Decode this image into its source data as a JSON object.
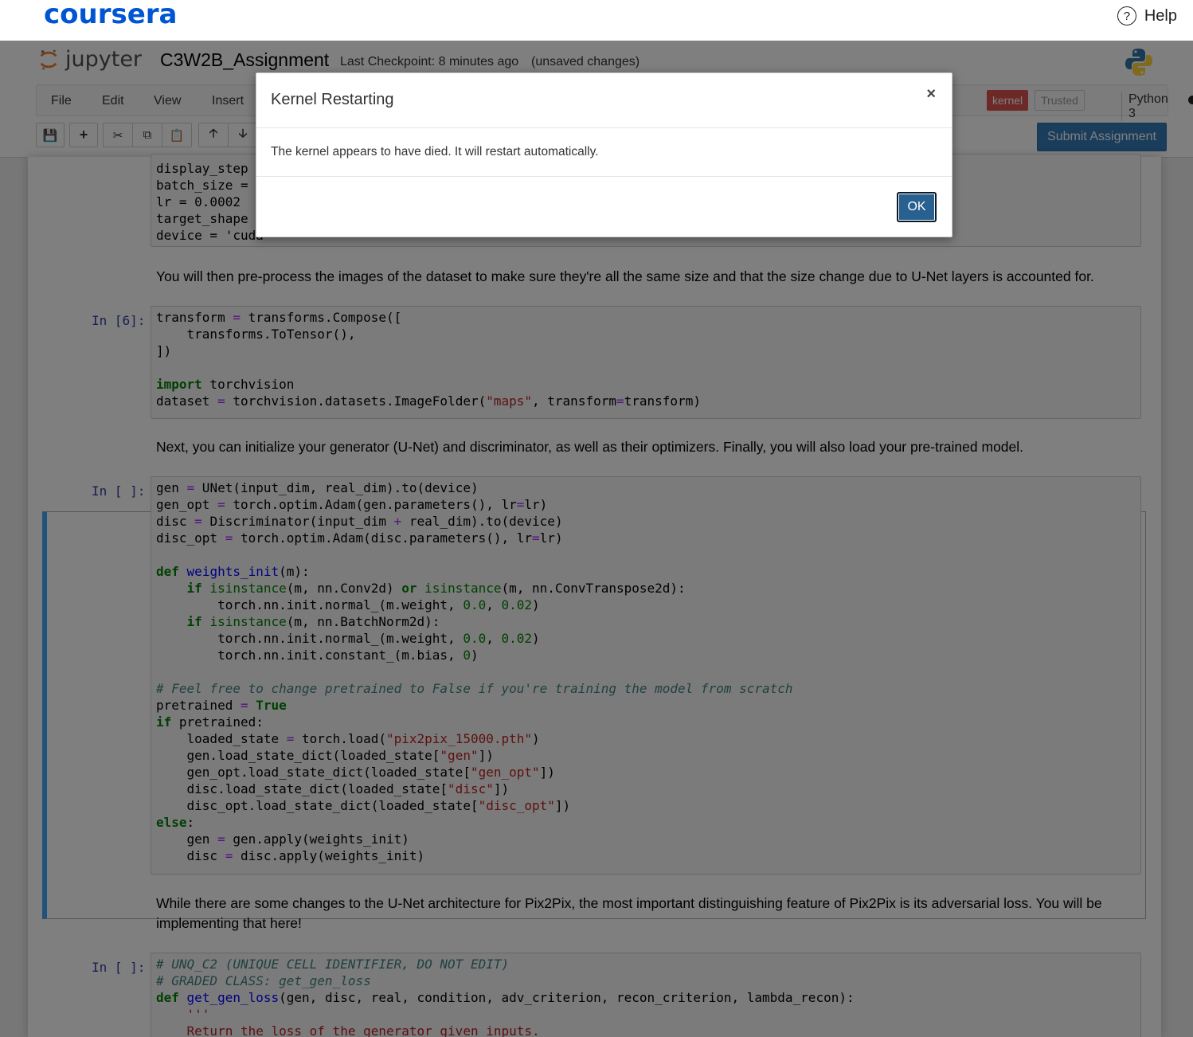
{
  "coursera": {
    "brand": "coursera",
    "help_label": "Help"
  },
  "jupyter": {
    "logo_text": "jupyter",
    "notebook_name": "C3W2B_Assignment",
    "checkpoint": "Last Checkpoint: 8 minutes ago",
    "unsaved": "(unsaved changes)"
  },
  "menubar": {
    "items": [
      "File",
      "Edit",
      "View",
      "Insert"
    ],
    "kernel_badge": "kernel",
    "trusted": "Trusted",
    "kernel_name": "Python 3"
  },
  "toolbar": {
    "buttons": [
      "save-icon",
      "plus-icon",
      "cut-icon",
      "copy-icon",
      "paste-icon",
      "arrow-up-icon",
      "arrow-down-icon"
    ],
    "submit_label": "Submit Assignment"
  },
  "cells": {
    "c5_lines": [
      "display_step",
      "batch_size =",
      "lr = 0.0002",
      "target_shape",
      "device = 'cuda"
    ],
    "md1": "You will then pre-process the images of the dataset to make sure they're all the same size and that the size change due to U-Net layers is accounted for.",
    "c6_prompt": "In [6]:",
    "md2": "Next, you can initialize your generator (U-Net) and discriminator, as well as their optimizers. Finally, you will also load your pre-trained model.",
    "c7_prompt": "In [ ]:",
    "md3": "While there are some changes to the U-Net architecture for Pix2Pix, the most important distinguishing feature of Pix2Pix is its adversarial loss. You will be implementing that here!",
    "c8_prompt": "In [ ]:"
  },
  "modal": {
    "title": "Kernel Restarting",
    "close": "×",
    "body": "The kernel appears to have died. It will restart automatically.",
    "ok_label": "OK"
  },
  "colors": {
    "coursera_blue": "#0056d2",
    "kernel_red": "#d9534f",
    "submit_blue": "#337ab7",
    "selected_cell": "#42a5f5"
  }
}
